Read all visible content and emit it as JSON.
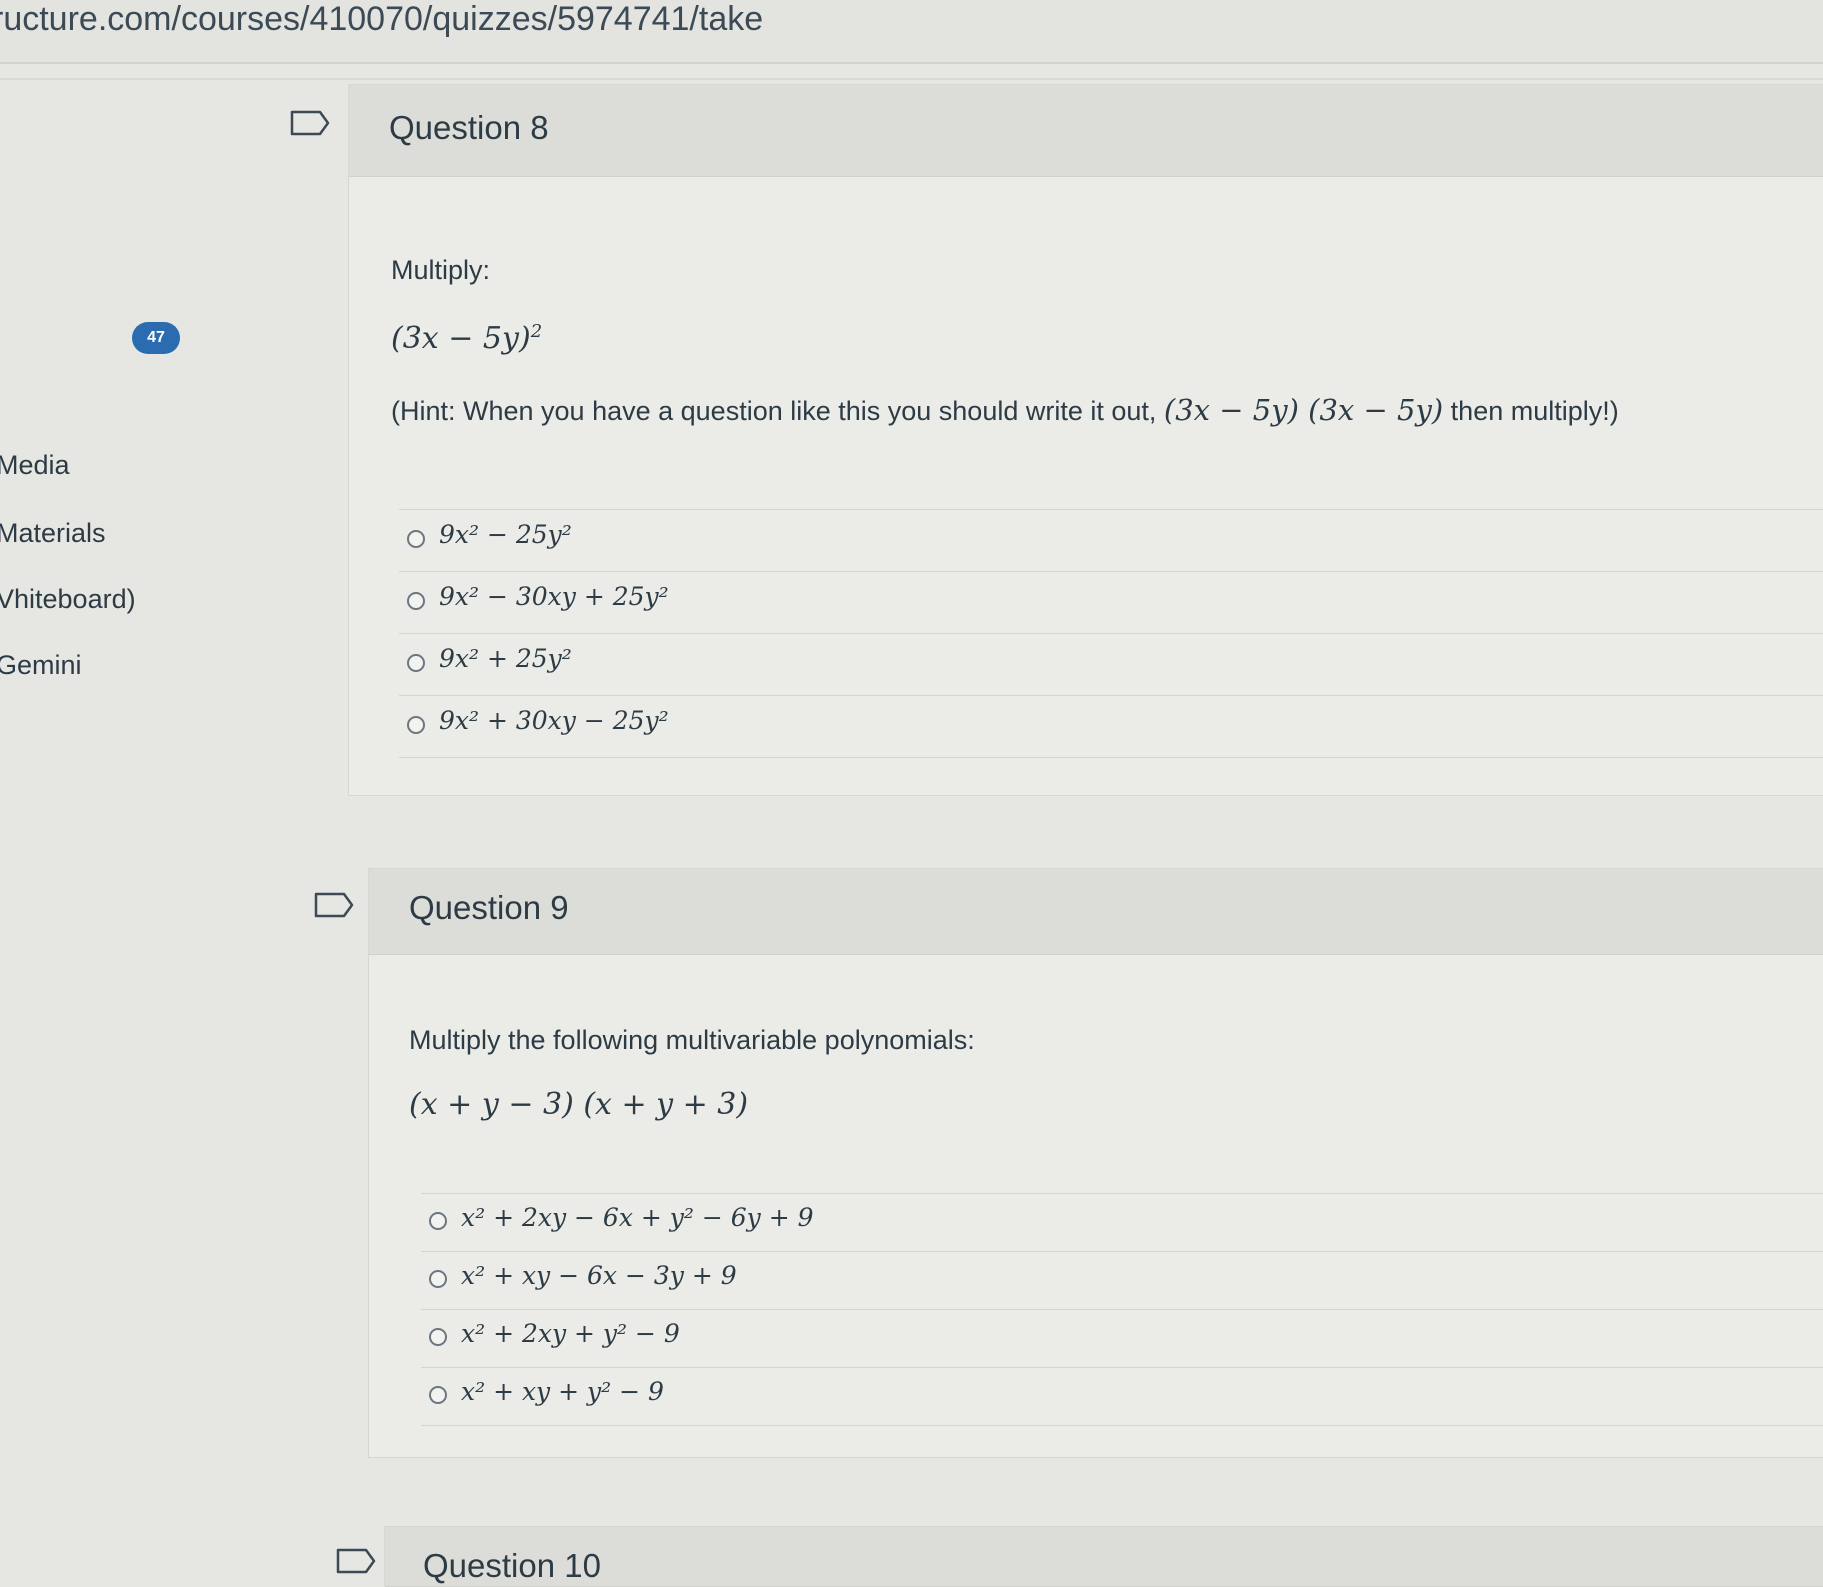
{
  "browser": {
    "url": "ructure.com/courses/410070/quizzes/5974741/take"
  },
  "sidebar": {
    "badge_count": "47",
    "items": [
      {
        "label": "Media"
      },
      {
        "label": "Materials"
      },
      {
        "label": "Vhiteboard)"
      },
      {
        "label": "Gemini"
      }
    ]
  },
  "questions": [
    {
      "title": "Question 8",
      "prompt": "Multiply:",
      "expression": "(3x − 5y)²",
      "hint_prefix": "(Hint: When you have a question like this you should write it out,",
      "hint_math": "(3x − 5y) (3x − 5y)",
      "hint_suffix": "then multiply!)",
      "answers": [
        "9x² − 25y²",
        "9x² − 30xy + 25y²",
        "9x² + 25y²",
        "9x² + 30xy − 25y²"
      ]
    },
    {
      "title": "Question 9",
      "prompt": "Multiply the following multivariable polynomials:",
      "expression": "(x + y − 3) (x + y + 3)",
      "answers": [
        "x² + 2xy − 6x + y² − 6y + 9",
        "x² + xy − 6x − 3y + 9",
        "x² + 2xy + y² − 9",
        "x² + xy + y² − 9"
      ]
    },
    {
      "title": "Question 10"
    }
  ],
  "colors": {
    "badge": "#2b6cb0",
    "header": "#dcdcd9",
    "text": "#2d3b45"
  }
}
